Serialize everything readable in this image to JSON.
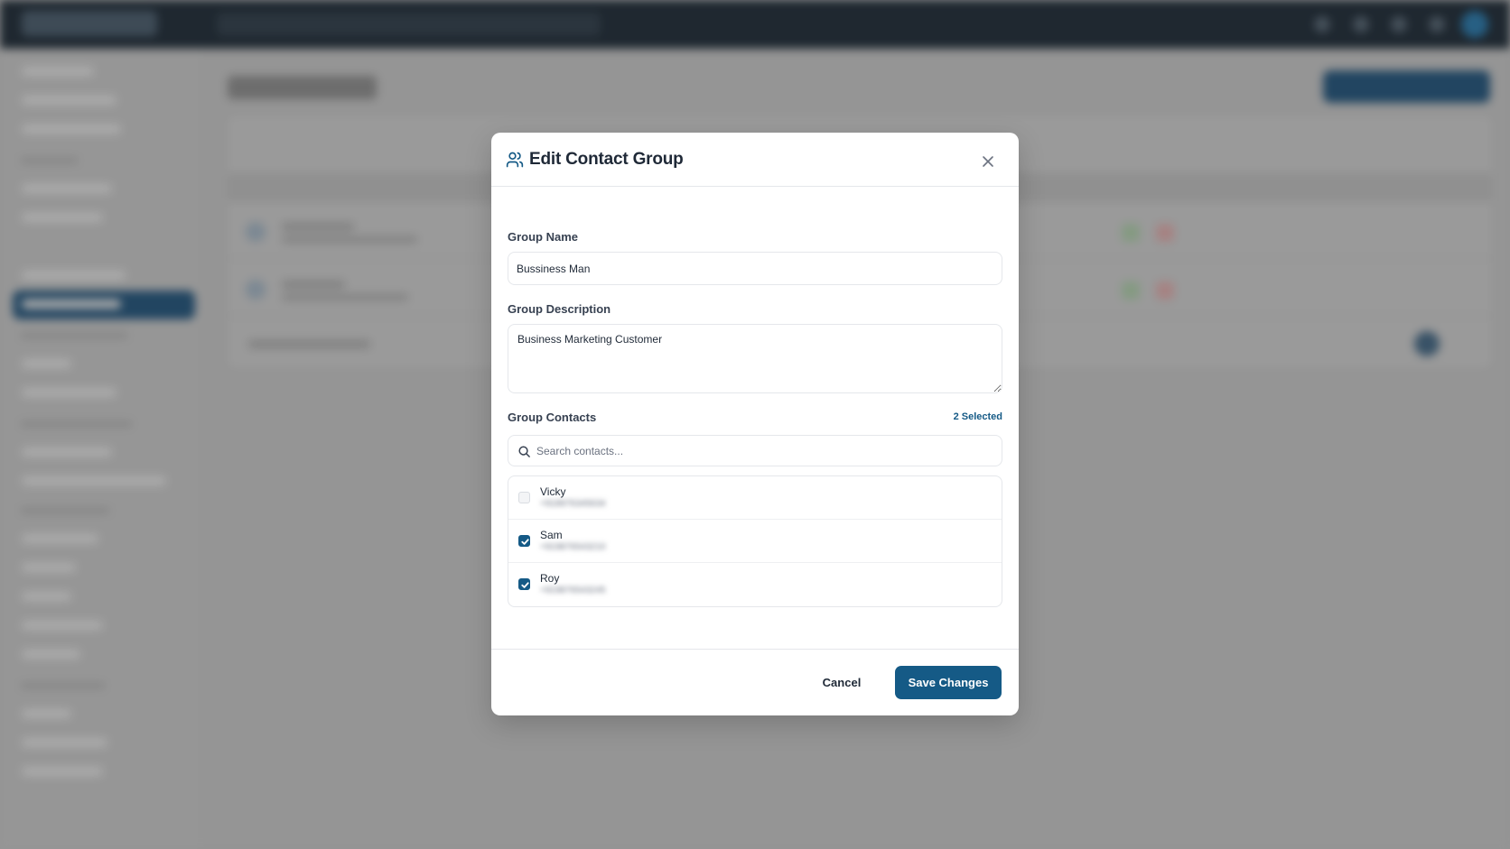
{
  "modal": {
    "title": "Edit Contact Group",
    "group_name_label": "Group Name",
    "group_name_value": "Bussiness Man",
    "group_description_label": "Group Description",
    "group_description_value": "Business Marketing Customer",
    "group_contacts_label": "Group Contacts",
    "selected_count": "2 Selected",
    "search_placeholder": "Search contacts...",
    "contacts": [
      {
        "name": "Vicky",
        "phone": "+918976345634",
        "checked": false
      },
      {
        "name": "Sam",
        "phone": "+919876543210",
        "checked": true
      },
      {
        "name": "Roy",
        "phone": "+919876543245",
        "checked": true
      }
    ],
    "cancel_label": "Cancel",
    "save_label": "Save Changes"
  },
  "icons": {
    "header": "users-icon",
    "close": "close-icon",
    "search": "search-icon",
    "checkbox": "check-icon"
  },
  "colors": {
    "primary": "#155a86",
    "topbar": "#0b1620",
    "sidebar_active": "#0f3a5c",
    "backdrop": "#9a9a9a"
  }
}
